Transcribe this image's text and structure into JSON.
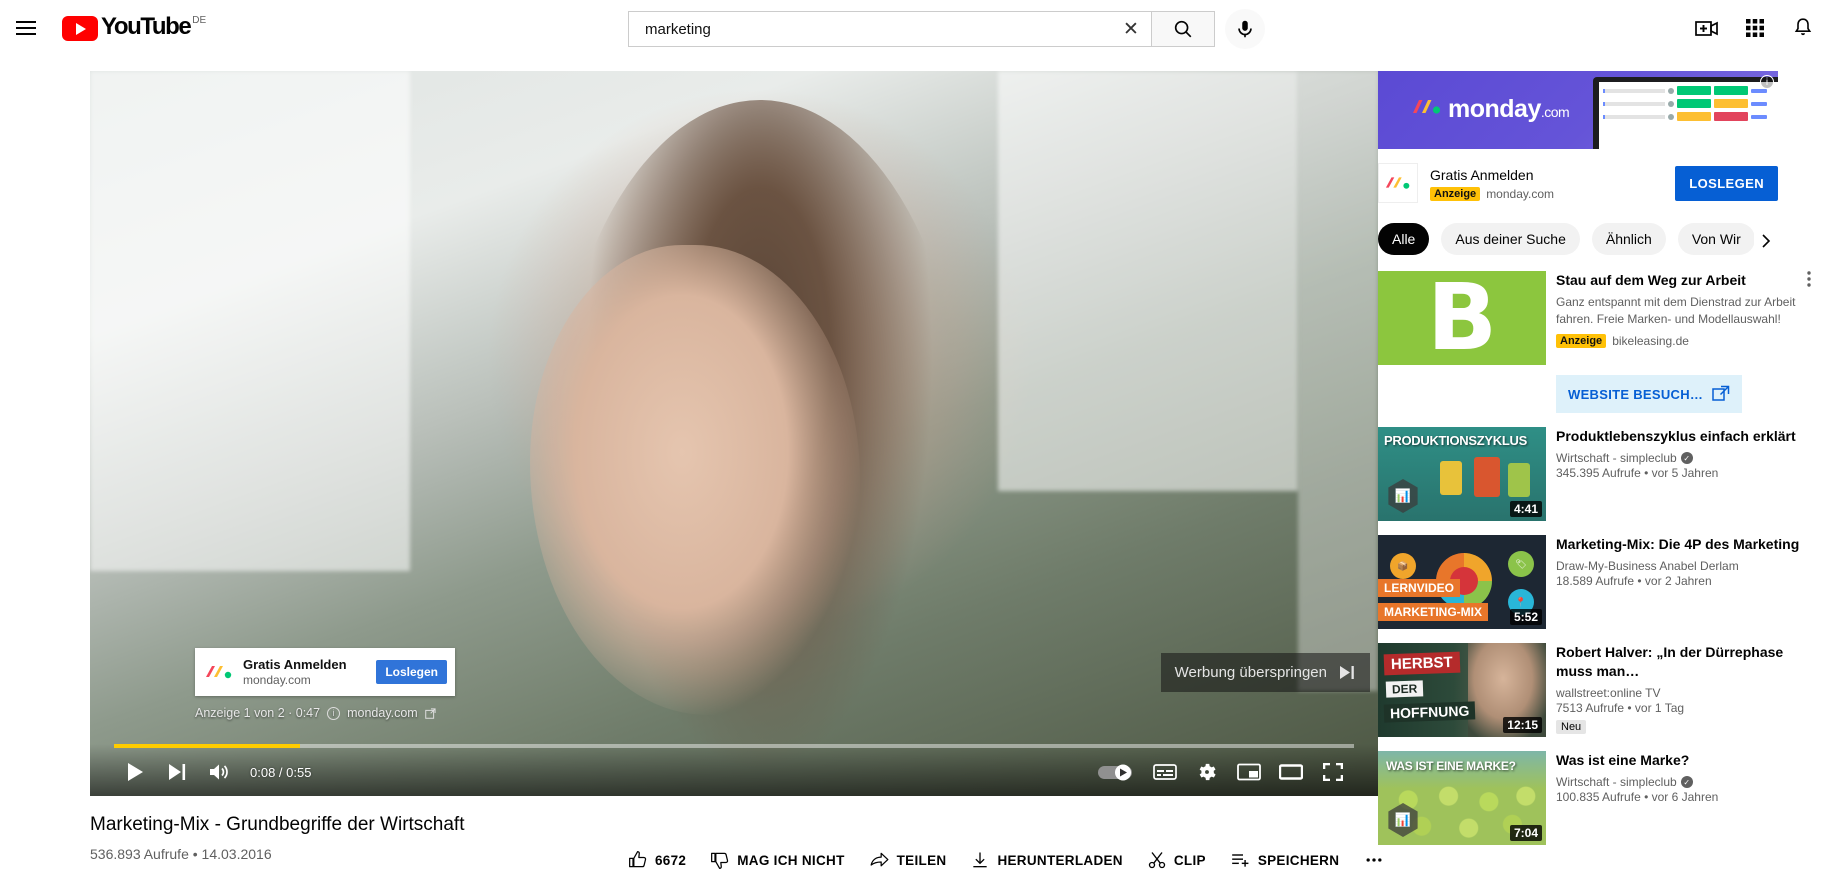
{
  "header": {
    "menu_label": "Guide",
    "logo_text": "YouTube",
    "country_code": "DE",
    "search": {
      "value": "marketing",
      "placeholder": "Suchen",
      "clear_label": "Suche löschen",
      "search_label": "Suchen",
      "mic_label": "Mit Stimme suchen"
    },
    "create_label": "Erstellen",
    "apps_label": "YouTube-Apps",
    "notifications_label": "Benachrichtigungen"
  },
  "player": {
    "ad_overlay": {
      "title": "Gratis Anmelden",
      "url": "monday.com",
      "cta": "Loslegen"
    },
    "ad_info": "Anzeige 1 von 2 · 0:47",
    "ad_advertiser": "monday.com",
    "skip_label": "Werbung überspringen",
    "time": "0:08 / 0:55",
    "progress_percent": 15,
    "play_label": "Wiedergabe",
    "next_label": "Weiter",
    "volume_label": "Stummschalten",
    "autoplay_label": "Autoplay",
    "subtitles_label": "Untertitel",
    "settings_label": "Einstellungen",
    "miniplayer_label": "Miniplayer",
    "theater_label": "Theatermodus",
    "fullscreen_label": "Vollbild"
  },
  "video": {
    "title": "Marketing-Mix - Grundbegriffe der Wirtschaft",
    "stats": "536.893 Aufrufe • 14.03.2016",
    "actions": [
      {
        "name": "like",
        "icon": "thumbs-up-icon",
        "label": "6672"
      },
      {
        "name": "dislike",
        "icon": "thumbs-down-icon",
        "label": "MAG ICH NICHT"
      },
      {
        "name": "share",
        "icon": "share-icon",
        "label": "TEILEN"
      },
      {
        "name": "download",
        "icon": "download-icon",
        "label": "HERUNTERLADEN"
      },
      {
        "name": "clip",
        "icon": "scissors-icon",
        "label": "CLIP"
      },
      {
        "name": "save",
        "icon": "save-playlist-icon",
        "label": "SPEICHERN"
      },
      {
        "name": "more",
        "icon": "more-horizontal-icon",
        "label": ""
      }
    ]
  },
  "sidebar": {
    "banner_ad": {
      "brand": "monday",
      "brand_suffix": ".com",
      "info_label": "Warum diese Anzeige?"
    },
    "promo": {
      "title": "Gratis Anmelden",
      "badge": "Anzeige",
      "source": "monday.com",
      "cta": "LOSLEGEN"
    },
    "chips": [
      {
        "label": "Alle",
        "active": true
      },
      {
        "label": "Aus deiner Suche",
        "active": false
      },
      {
        "label": "Ähnlich",
        "active": false
      },
      {
        "label": "Von Wir",
        "active": false
      }
    ],
    "chips_next_label": "Weiter",
    "bike_ad": {
      "thumb_letter": "B",
      "title": "Stau auf dem Weg zur Arbeit",
      "description": "Ganz entspannt mit dem Dienstrad zur Arbeit fahren. Freie Marken- und Modellauswahl!",
      "badge": "Anzeige",
      "source": "bikeleasing.de",
      "cta": "WEBSITE BESUCH…",
      "menu_label": "Aktionsmenü"
    },
    "related": [
      {
        "thumb_class": "th-prod",
        "thumb_label": "PRODUKTIONSZYKLUS",
        "duration": "4:41",
        "title": "Produktlebenszyklus einfach erklärt",
        "channel": "Wirtschaft - simpleclub",
        "verified": true,
        "stats": "345.395 Aufrufe • vor 5 Jahren",
        "badge": ""
      },
      {
        "thumb_class": "th-mkt",
        "thumb_label": "",
        "band_top": "LERNVIDEO",
        "band_bottom": "MARKETING-MIX",
        "duration": "5:52",
        "title": "Marketing-Mix: Die 4P des Marketing",
        "channel": "Draw-My-Business Anabel Derlam",
        "verified": false,
        "stats": "18.589 Aufrufe • vor 2 Jahren",
        "badge": ""
      },
      {
        "thumb_class": "th-herbst",
        "thumb_label": "",
        "band_red": "HERBST",
        "band_white": "DER",
        "band_white2": "HOFFNUNG",
        "duration": "12:15",
        "title": "Robert Halver: „In der Dürrephase muss man…",
        "channel": "wallstreet:online TV",
        "verified": false,
        "stats": "7513 Aufrufe • vor 1 Tag",
        "badge": "Neu"
      },
      {
        "thumb_class": "th-marke",
        "thumb_label": "WAS IST EINE MARKE?",
        "duration": "7:04",
        "title": "Was ist eine Marke?",
        "channel": "Wirtschaft - simpleclub",
        "verified": true,
        "stats": "100.835 Aufrufe • vor 6 Jahren",
        "badge": ""
      }
    ]
  },
  "colors": {
    "youtube_red": "#FF0000",
    "link_blue": "#065fd4",
    "ad_yellow": "#FFC107",
    "ad_progress": "#ffcc00",
    "monday_purple": "#5b4ad4",
    "bike_green": "#8CC63E"
  }
}
